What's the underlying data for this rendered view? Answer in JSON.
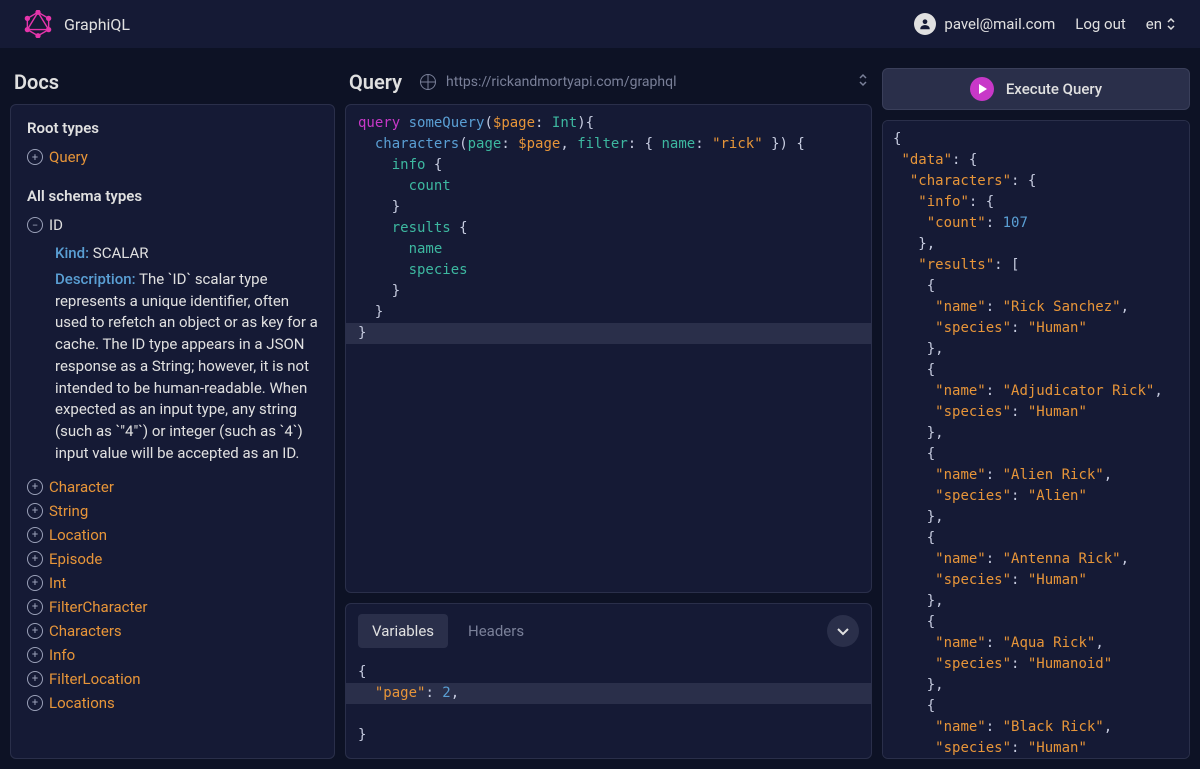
{
  "header": {
    "app_title": "GraphiQL",
    "user_email": "pavel@mail.com",
    "logout_label": "Log out",
    "lang": "en"
  },
  "docs": {
    "title": "Docs",
    "root_types_title": "Root types",
    "root_types": [
      {
        "label": "Query"
      }
    ],
    "all_schema_types_title": "All schema types",
    "expanded_type": {
      "name": "ID",
      "kind_label": "Kind:",
      "kind_value": "SCALAR",
      "description_label": "Description:",
      "description": "The `ID` scalar type represents a unique identifier, often used to refetch an object or as key for a cache. The ID type appears in a JSON response as a String; however, it is not intended to be human-readable. When expected as an input type, any string (such as `\"4\"`) or integer (such as `4`) input value will be accepted as an ID."
    },
    "schema_types": [
      {
        "label": "Character"
      },
      {
        "label": "String"
      },
      {
        "label": "Location"
      },
      {
        "label": "Episode"
      },
      {
        "label": "Int"
      },
      {
        "label": "FilterCharacter"
      },
      {
        "label": "Characters"
      },
      {
        "label": "Info"
      },
      {
        "label": "FilterLocation"
      },
      {
        "label": "Locations"
      }
    ]
  },
  "query": {
    "title": "Query",
    "endpoint": "https://rickandmortyapi.com/graphql",
    "tokens": {
      "kw_query": "query",
      "name": "someQuery",
      "param_var": "$page",
      "param_type": "Int",
      "field_characters": "characters",
      "arg_page": "page",
      "arg_filter": "filter",
      "arg_name": "name",
      "arg_name_val": "\"rick\"",
      "field_info": "info",
      "field_count": "count",
      "field_results": "results",
      "field_name": "name",
      "field_species": "species"
    }
  },
  "variables": {
    "tab_variables": "Variables",
    "tab_headers": "Headers",
    "key_page": "\"page\"",
    "val_page": "2"
  },
  "result": {
    "execute_label": "Execute Query",
    "data": {
      "characters": {
        "info": {
          "count": 107
        },
        "results": [
          {
            "name": "Rick Sanchez",
            "species": "Human"
          },
          {
            "name": "Adjudicator Rick",
            "species": "Human"
          },
          {
            "name": "Alien Rick",
            "species": "Alien"
          },
          {
            "name": "Antenna Rick",
            "species": "Human"
          },
          {
            "name": "Aqua Rick",
            "species": "Humanoid"
          },
          {
            "name": "Black Rick",
            "species": "Human"
          }
        ]
      }
    }
  }
}
